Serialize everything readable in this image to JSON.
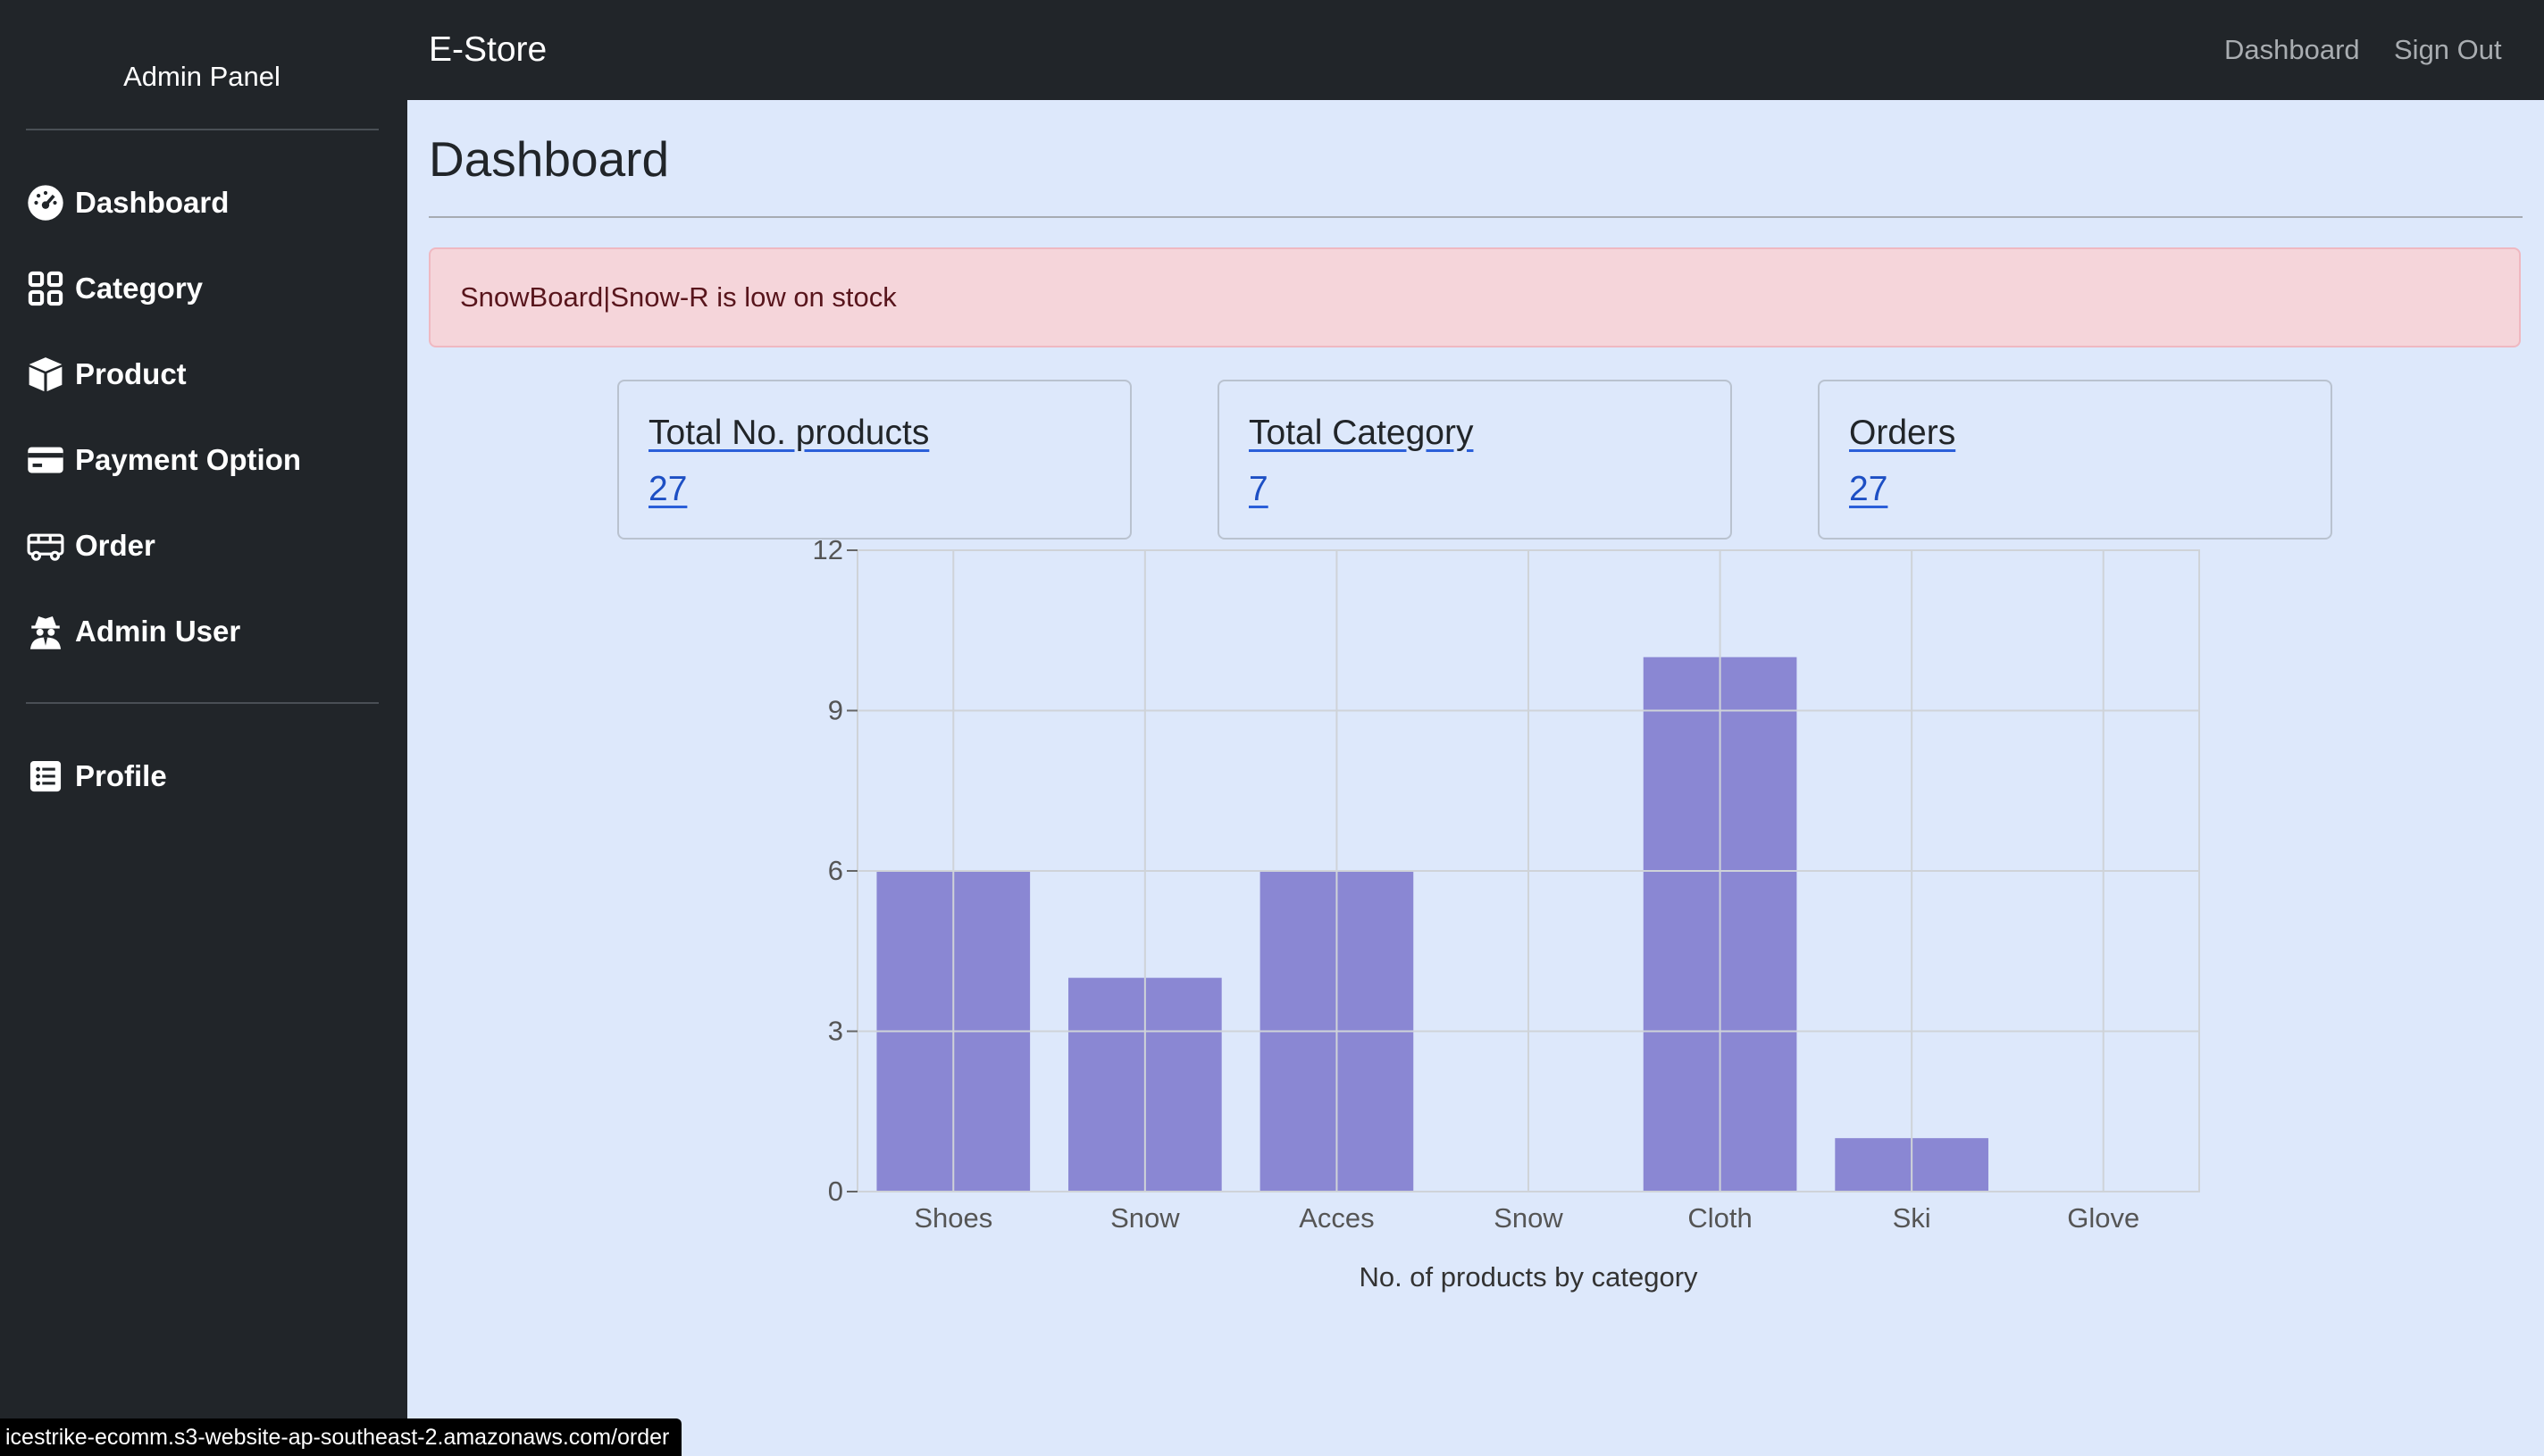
{
  "sidebar": {
    "title": "Admin Panel",
    "items": [
      {
        "label": "Dashboard",
        "icon": "speedometer-icon"
      },
      {
        "label": "Category",
        "icon": "grid-icon"
      },
      {
        "label": "Product",
        "icon": "box-icon"
      },
      {
        "label": "Payment Option",
        "icon": "credit-card-icon"
      },
      {
        "label": "Order",
        "icon": "truck-icon"
      },
      {
        "label": "Admin User",
        "icon": "incognito-user-icon"
      }
    ],
    "profile": {
      "label": "Profile",
      "icon": "list-icon"
    }
  },
  "topbar": {
    "brand": "E-Store",
    "nav": [
      "Dashboard",
      "Sign Out"
    ]
  },
  "main": {
    "title": "Dashboard",
    "alert": "SnowBoard|Snow-R is low on stock",
    "cards": [
      {
        "label": "Total No. products",
        "value": "27"
      },
      {
        "label": "Total Category",
        "value": "7"
      },
      {
        "label": "Orders",
        "value": "27"
      }
    ]
  },
  "chart_data": {
    "type": "bar",
    "categories": [
      "Shoes",
      "Snow",
      "Acces",
      "Snow",
      "Cloth",
      "Ski",
      "Glove"
    ],
    "values": [
      6,
      4,
      6,
      0,
      10,
      1,
      0
    ],
    "xlabel": "No. of products by category",
    "ylabel": "",
    "ylim": [
      0,
      12
    ],
    "yticks": [
      0,
      3,
      6,
      9,
      12
    ],
    "grid": true,
    "bar_color": "#8a87d3"
  },
  "statusbar": {
    "url": "icestrike-ecomm.s3-website-ap-southeast-2.amazonaws.com/order"
  },
  "colors": {
    "sidebar_bg": "#212529",
    "page_bg": "#dde8fb",
    "alert_bg": "#f5d5da",
    "link": "#1d4fc4"
  }
}
